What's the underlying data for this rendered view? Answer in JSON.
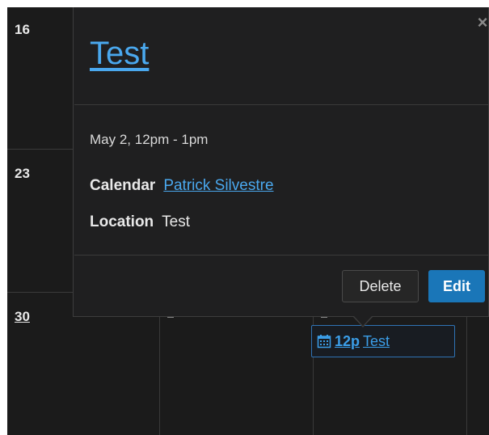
{
  "calendar": {
    "day_numbers": [
      "16",
      "23",
      "30"
    ],
    "event": {
      "time": "12p",
      "title": "Test",
      "icon": "calendar-icon"
    }
  },
  "popover": {
    "title": "Test",
    "close_label": "×",
    "datetime": "May 2, 12pm - 1pm",
    "calendar_label": "Calendar",
    "calendar_value": "Patrick Silvestre",
    "location_label": "Location",
    "location_value": "Test",
    "delete_label": "Delete",
    "edit_label": "Edit"
  },
  "colors": {
    "accent": "#4aa8ee",
    "primary_button": "#1a76b8",
    "background": "#1b1b1b"
  }
}
